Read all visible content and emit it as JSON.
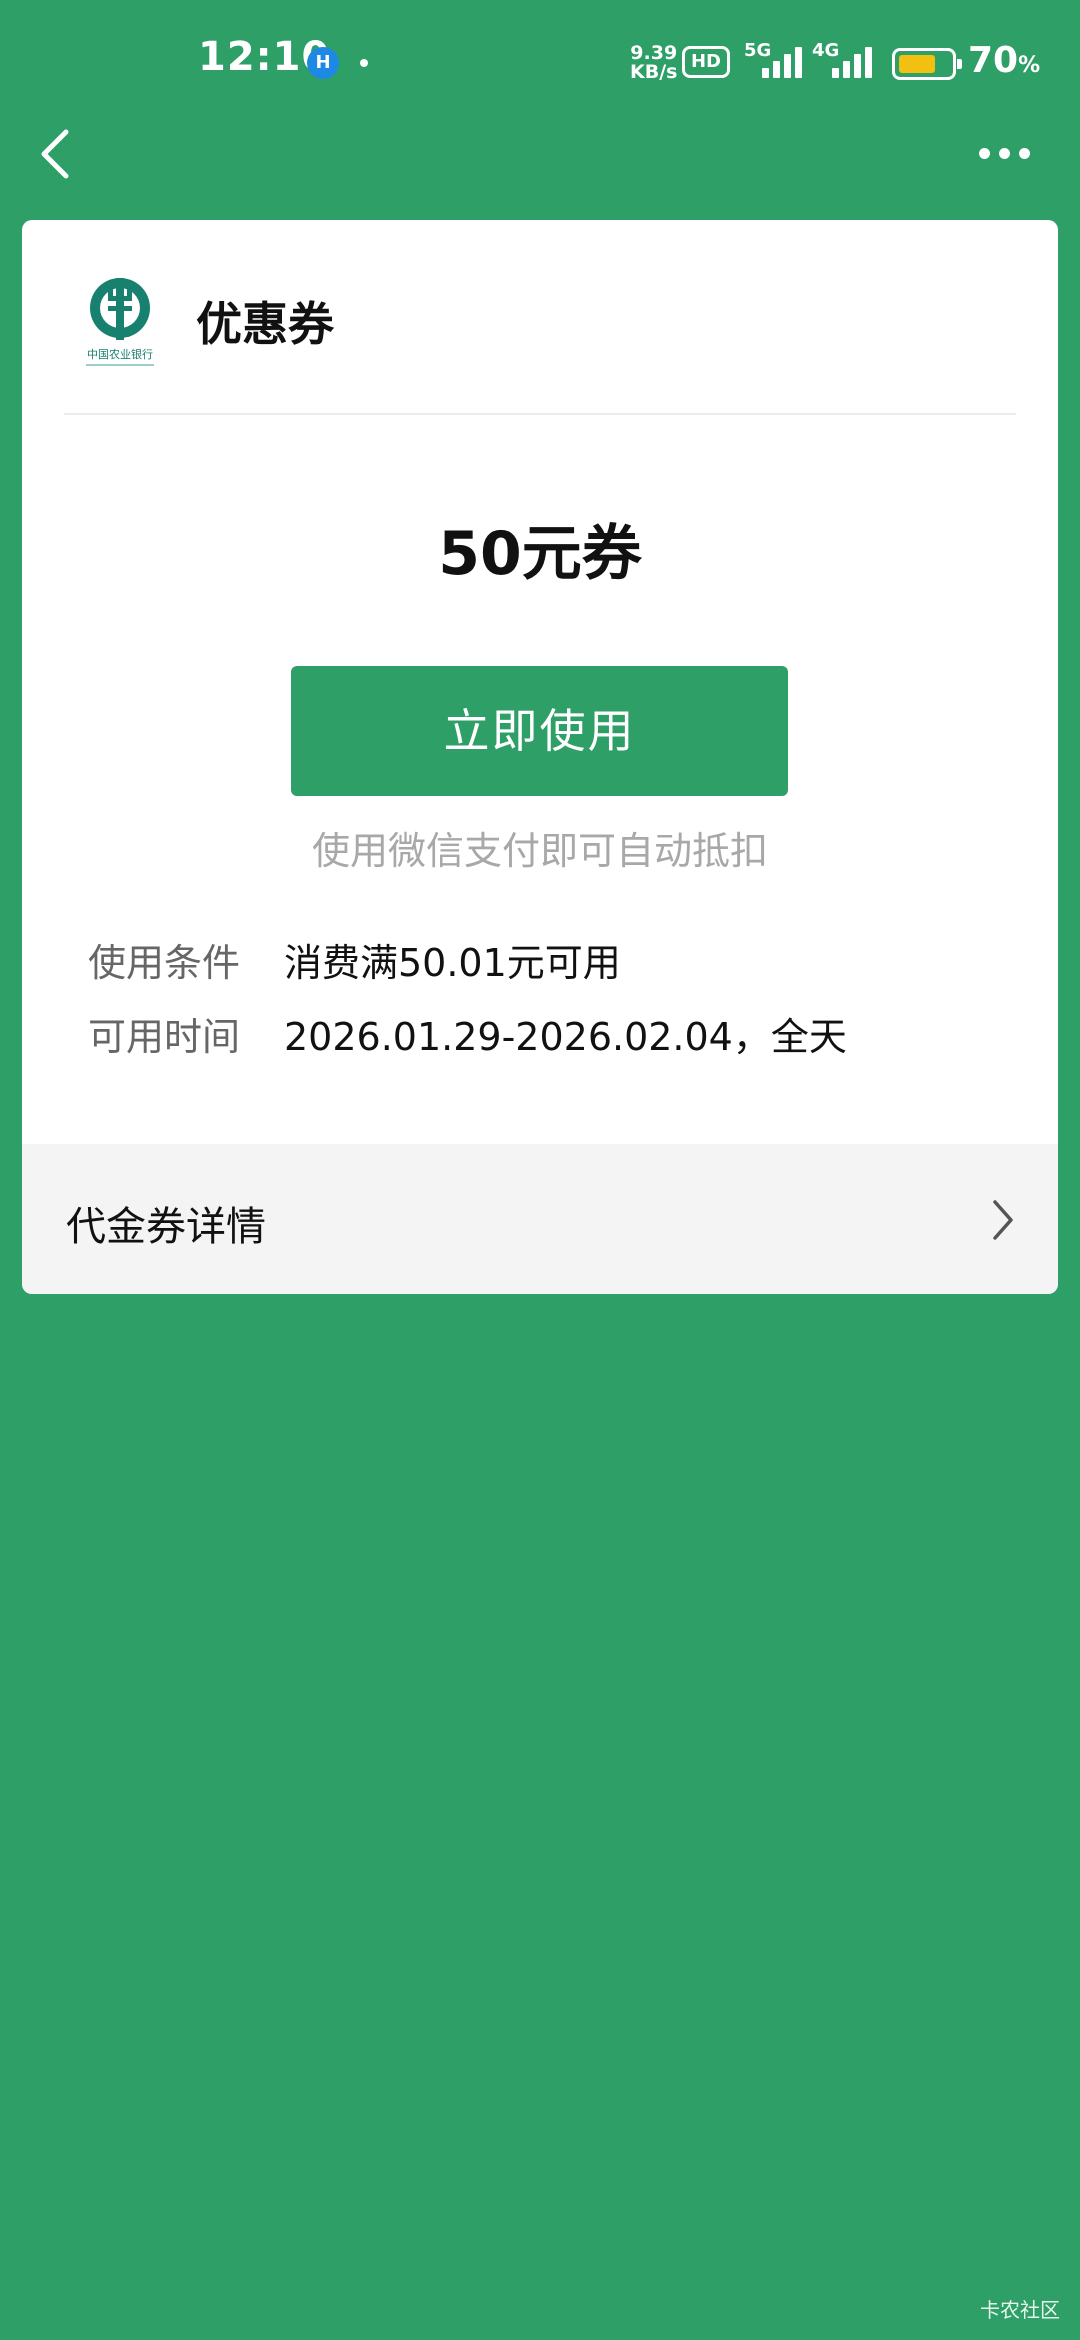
{
  "status_bar": {
    "time": "12:10",
    "app_badge": "H",
    "speed_value": "9.39",
    "speed_unit": "KB/s",
    "hd_label": "HD",
    "net_5g": "5G",
    "net_4g": "4G",
    "battery_level": 0.7,
    "battery_percent": "70",
    "battery_percent_sign": "%",
    "icons": [
      "app-notification-icon",
      "signal-5g-icon",
      "signal-4g-icon",
      "battery-icon"
    ]
  },
  "nav": {
    "back_icon": "chevron-left-icon",
    "more_icon": "more-dots-icon"
  },
  "coupon": {
    "logo": "agricultural-bank-logo",
    "logo_text": "中国农业银行",
    "title": "优惠券",
    "amount": "50元券",
    "use_button": "立即使用",
    "hint": "使用微信支付即可自动抵扣",
    "conditions_label": "使用条件",
    "conditions_value": "消费满50.01元可用",
    "time_label": "可用时间",
    "time_value": "2026.01.29-2026.02.04，全天",
    "details_label": "代金券详情"
  },
  "watermark": "卡农社区",
  "colors": {
    "brand_green": "#2e9f66",
    "logo_teal": "#17806f",
    "battery_yellow": "#f2c011"
  }
}
